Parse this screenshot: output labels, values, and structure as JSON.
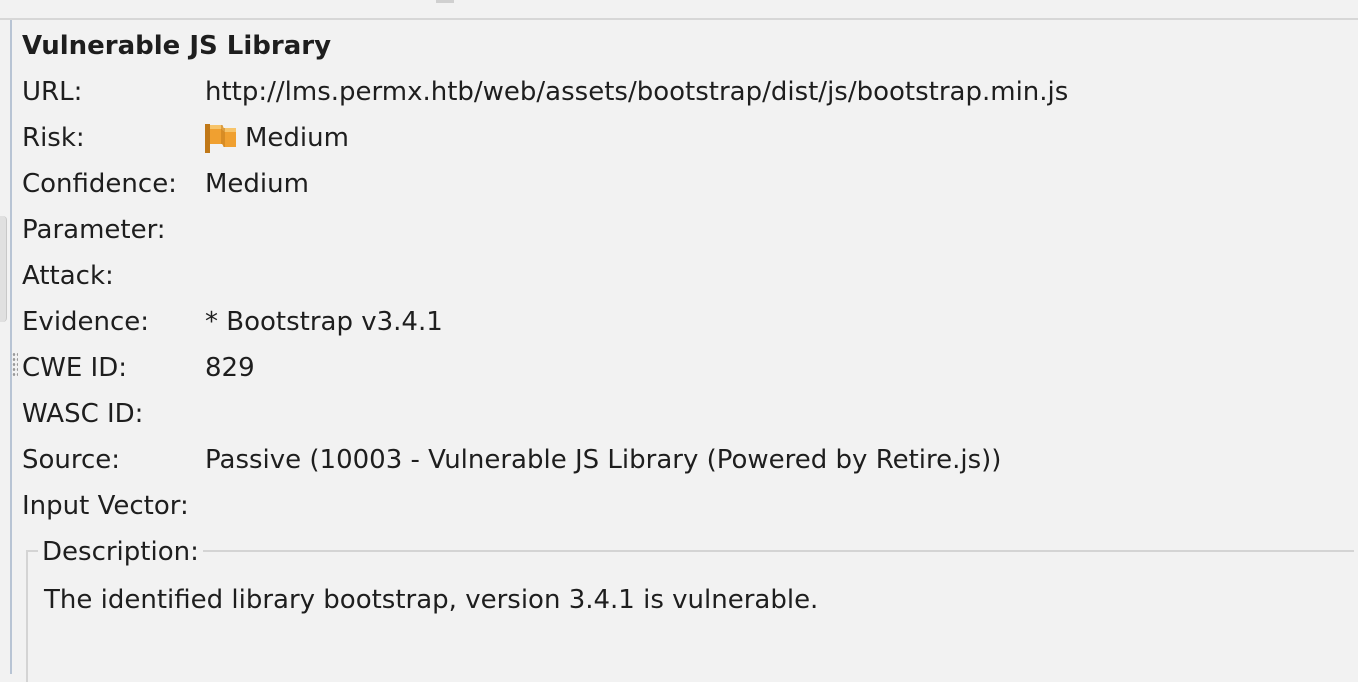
{
  "alert": {
    "title": "Vulnerable JS Library",
    "fields": {
      "url": {
        "label": "URL:",
        "value": "http://lms.permx.htb/web/assets/bootstrap/dist/js/bootstrap.min.js"
      },
      "risk": {
        "label": "Risk:",
        "value": "Medium",
        "icon": "orange-flag-icon",
        "icon_color": "#f0a030"
      },
      "confidence": {
        "label": "Confidence:",
        "value": "Medium"
      },
      "parameter": {
        "label": "Parameter:",
        "value": ""
      },
      "attack": {
        "label": "Attack:",
        "value": ""
      },
      "evidence": {
        "label": "Evidence:",
        "value": "* Bootstrap v3.4.1"
      },
      "cwe_id": {
        "label": "CWE ID:",
        "value": "829"
      },
      "wasc_id": {
        "label": "WASC ID:",
        "value": ""
      },
      "source": {
        "label": "Source:",
        "value": "Passive (10003 - Vulnerable JS Library (Powered by Retire.js))"
      },
      "input_vector": {
        "label": "Input Vector:",
        "value": ""
      }
    },
    "description": {
      "legend": "Description:",
      "text": "The identified library bootstrap, version 3.4.1 is vulnerable."
    }
  }
}
